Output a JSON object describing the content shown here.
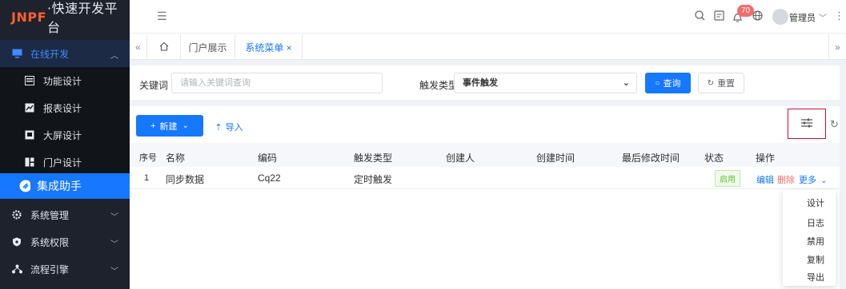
{
  "sidebar": {
    "logo_brand": "JNPF",
    "logo_suffix": "·快速开发平台",
    "group_label": "在线开发",
    "items": [
      {
        "label": "功能设计",
        "icon": "form-icon"
      },
      {
        "label": "报表设计",
        "icon": "report-icon"
      },
      {
        "label": "大屏设计",
        "icon": "screen-icon"
      },
      {
        "label": "门户设计",
        "icon": "portal-icon"
      }
    ],
    "active_label": "集成助手",
    "sections": [
      {
        "label": "系统管理",
        "icon": "gear-icon"
      },
      {
        "label": "系统权限",
        "icon": "shield-icon"
      },
      {
        "label": "流程引擎",
        "icon": "flow-icon"
      }
    ]
  },
  "header": {
    "badge_count": "70",
    "user_label": "管理员"
  },
  "tabs": [
    {
      "label": "门户展示"
    },
    {
      "label": "系统菜单 ×"
    }
  ],
  "search": {
    "keyword_label": "关键词",
    "keyword_placeholder": "请输入关键词查询",
    "trigger_label": "触发类型",
    "trigger_value": "事件触发",
    "query_button": "查询",
    "reset_button": "重置"
  },
  "toolbar": {
    "new_button": "新建",
    "import_button": "导入"
  },
  "table": {
    "columns": [
      "序号",
      "名称",
      "编码",
      "触发类型",
      "创建人",
      "创建时间",
      "最后修改时间",
      "状态",
      "操作"
    ],
    "rows": [
      {
        "index": "1",
        "name": "同步数据",
        "code": "Cq22",
        "trigger": "定时触发",
        "creator": "",
        "created": "",
        "modified": "",
        "status": "启用",
        "actions": {
          "edit": "编辑",
          "delete": "删除",
          "more": "更多"
        }
      }
    ]
  },
  "dropdown": {
    "items": [
      "设计",
      "日志",
      "禁用",
      "复制",
      "导出"
    ]
  },
  "colors": {
    "accent": "#1677ff",
    "sidebar": "#1e222d",
    "danger": "#f56c6c",
    "success": "#67c23a",
    "highlight_border": "#c8102e"
  }
}
